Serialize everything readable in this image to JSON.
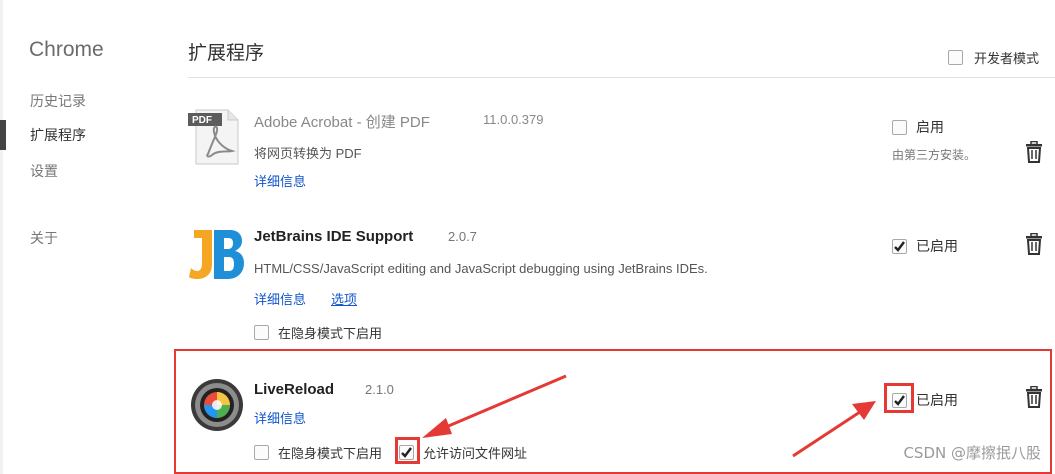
{
  "sidebar": {
    "brand": "Chrome",
    "items": [
      {
        "label": "历史记录"
      },
      {
        "label": "扩展程序"
      },
      {
        "label": "设置"
      },
      {
        "label": "关于"
      }
    ]
  },
  "header": {
    "title": "扩展程序",
    "dev_mode_label": "开发者模式"
  },
  "extensions": [
    {
      "name": "Adobe Acrobat - 创建 PDF",
      "version": "11.0.0.379",
      "description": "将网页转换为 PDF",
      "details_link": "详细信息",
      "enable_label": "启用",
      "enabled": false,
      "note": "由第三方安装。",
      "icon": "pdf-icon"
    },
    {
      "name": "JetBrains IDE Support",
      "version": "2.0.7",
      "description": "HTML/CSS/JavaScript editing and JavaScript debugging using JetBrains IDEs.",
      "details_link": "详细信息",
      "options_link": "选项",
      "incognito_label": "在隐身模式下启用",
      "enable_label": "已启用",
      "enabled": true,
      "icon": "jetbrains-icon"
    },
    {
      "name": "LiveReload",
      "version": "2.1.0",
      "details_link": "详细信息",
      "incognito_label": "在隐身模式下启用",
      "file_access_label": "允许访问文件网址",
      "enable_label": "已启用",
      "enabled": true,
      "icon": "livereload-icon"
    }
  ],
  "watermark": "CSDN @摩擦抿八股",
  "colors": {
    "highlight": "#e53935",
    "link": "#1155cc"
  }
}
